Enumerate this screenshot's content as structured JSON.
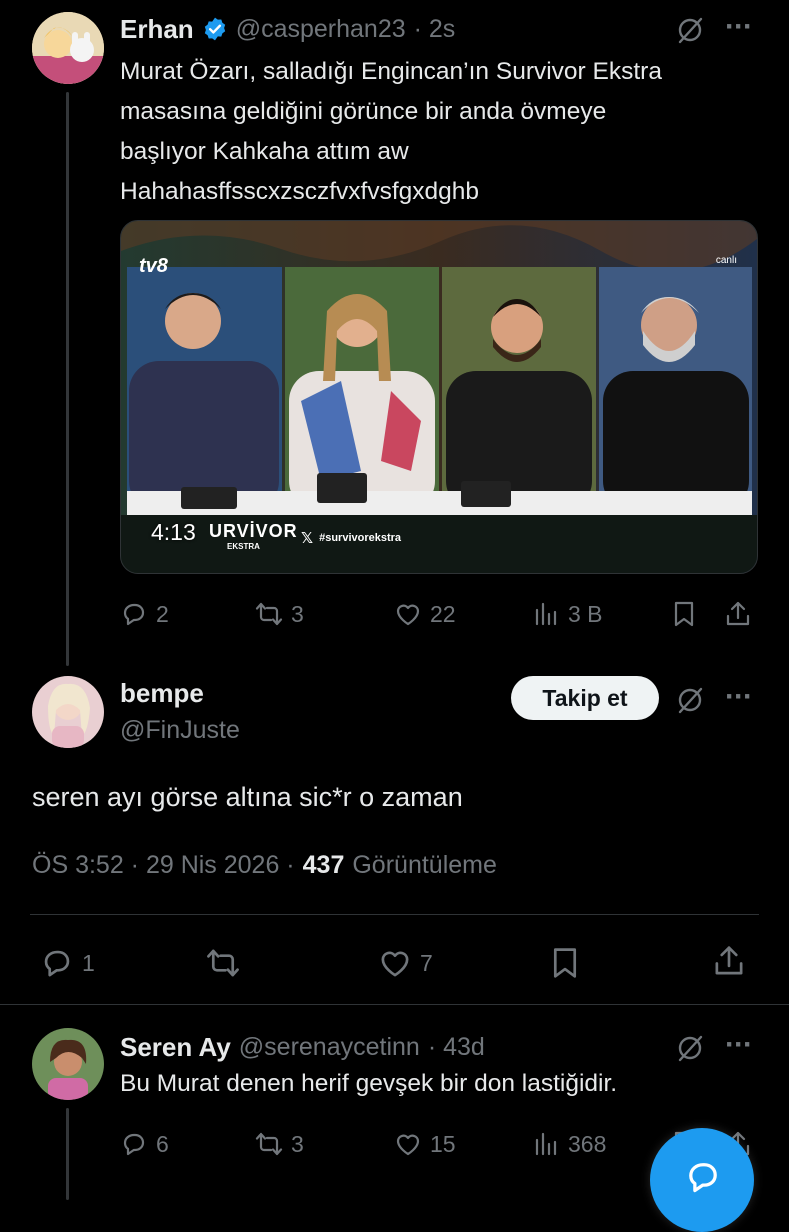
{
  "tweet1": {
    "name": "Erhan",
    "handle": "@casperhan23",
    "time": "· 2s",
    "text_lines": [
      "Murat Özarı, salladığı Engincan’ın Survivor Ekstra",
      "masasına geldiğini görünce bir anda övmeye",
      "başlıyor Kahkaha attım aw",
      "Hahahasffsscxzsczfvxfvsfgxdghb"
    ],
    "video": {
      "duration": "4:13",
      "channel_logo": "tv8",
      "top_right_logo": "canlı",
      "show_logo": "URVİVOR",
      "show_sub": "EKSTRA",
      "hashtag": "#survivorekstra"
    },
    "actions": {
      "replies": "2",
      "retweets": "3",
      "likes": "22",
      "views": "3 B"
    }
  },
  "tweet2": {
    "name": "bempe",
    "handle": "@FinJuste",
    "follow_label": "Takip et",
    "text": "seren ayı görse altına sic*r o zaman",
    "meta_time": "ÖS 3:52 · 29 Nis 2026 ·",
    "views_count": "437",
    "views_label": "Görüntüleme",
    "actions": {
      "replies": "1",
      "likes": "7"
    }
  },
  "tweet3": {
    "name": "Seren Ay",
    "handle": "@serenaycetinn",
    "time": "· 43d",
    "text": "Bu Murat denen herif gevşek bir don lastiğidir.",
    "actions": {
      "replies": "6",
      "retweets": "3",
      "likes": "15",
      "views": "368"
    }
  },
  "colors": {
    "background": "#000000",
    "text": "#e7e9ea",
    "muted": "#71767b",
    "verified": "#1d9bf0",
    "fab": "#1d9bf0"
  },
  "icons": [
    "verified-badge-icon",
    "grok-icon",
    "more-icon",
    "reply-icon",
    "retweet-icon",
    "like-icon",
    "views-icon",
    "bookmark-icon",
    "share-icon",
    "compose-icon"
  ]
}
